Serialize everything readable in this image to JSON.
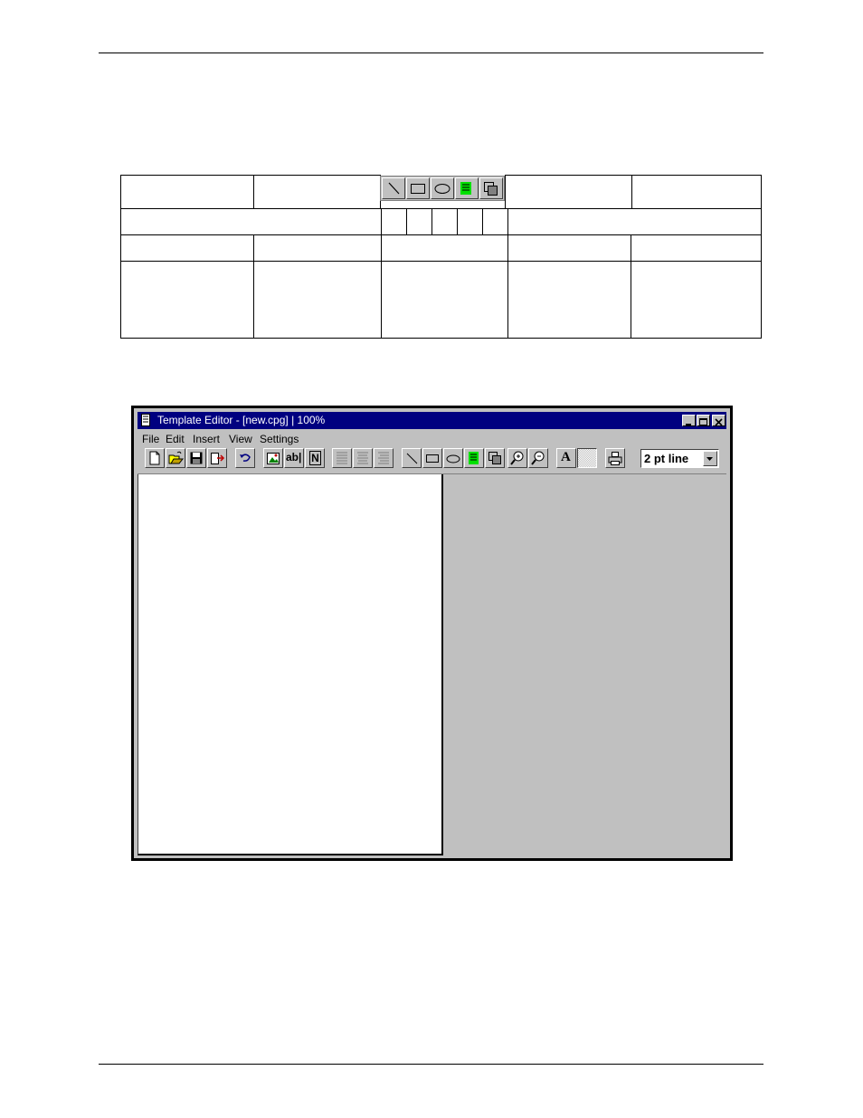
{
  "reference_toolbar": {
    "icons": [
      "line-icon",
      "rectangle-icon",
      "ellipse-icon",
      "text-block-icon",
      "layers-icon"
    ]
  },
  "window": {
    "title": "Template Editor - [new.cpg] | 100%",
    "controls": [
      "minimize",
      "maximize",
      "close"
    ]
  },
  "menu": {
    "items": [
      "File",
      "Edit",
      "Insert",
      "View",
      "Settings"
    ]
  },
  "toolbar": {
    "groups": [
      [
        "new-icon",
        "open-icon",
        "save-icon",
        "exit-icon"
      ],
      [
        "undo-icon"
      ],
      [
        "insert-image-icon",
        "text-field-icon",
        "number-field-icon"
      ],
      [
        "align-left-icon",
        "align-center-icon",
        "align-right-icon"
      ],
      [
        "line-icon",
        "rectangle-icon",
        "ellipse-icon",
        "text-block-icon",
        "layers-icon"
      ],
      [
        "zoom-in-icon",
        "zoom-out-icon"
      ],
      [
        "font-icon",
        "pattern-icon"
      ],
      [
        "print-icon"
      ]
    ],
    "text_field_label": "ab|",
    "number_field_label": "N",
    "font_label": "A",
    "line_width": "2 pt line"
  },
  "colors": {
    "titlebar": "#000080",
    "chrome": "#c0c0c0",
    "accent_green": "#00ff00"
  }
}
